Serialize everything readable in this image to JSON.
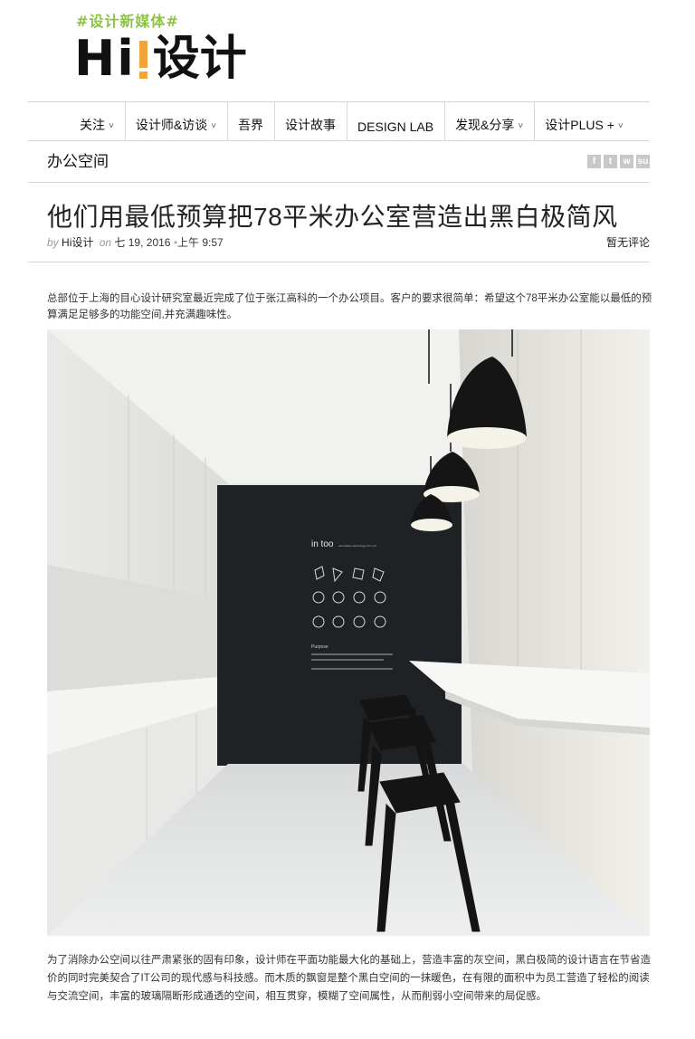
{
  "header": {
    "tagline": "#设计新媒体#",
    "logo_hi": "Hi",
    "logo_cn": "设计"
  },
  "nav": [
    {
      "label": "关注",
      "caret": true
    },
    {
      "label": "设计师&访谈",
      "caret": true
    },
    {
      "label": "吾界",
      "caret": false
    },
    {
      "label": "设计故事",
      "caret": false
    },
    {
      "label": "DESIGN LAB",
      "caret": false
    },
    {
      "label": "发现&分享",
      "caret": true
    },
    {
      "label": "设计PLUS +",
      "caret": true
    }
  ],
  "section": "办公空间",
  "social_icons": [
    "facebook-icon",
    "twitter-icon",
    "weibo-icon",
    "stumbleupon-icon"
  ],
  "social_glyphs": [
    "f",
    "t",
    "w",
    "su"
  ],
  "article": {
    "title": "他们用最低预算把78平米办公室营造出黑白极简风",
    "by": "by",
    "author": "Hi设计",
    "on": "on",
    "date": "七 19, 2016",
    "time": "上午 9:57",
    "comments": "暂无评论",
    "intro": "总部位于上海的目心设计研究室最近完成了位于张江高科的一个办公项目。客户的要求很简单：希望这个78平米办公室能以最低的预算满足足够多的功能空间,并充满趣味性。",
    "body": "为了消除办公空间以往严肃紧张的固有印象，设计师在平面功能最大化的基础上，营造丰富的灰空间，黑白极简的设计语言在节省造价的同时完美契合了IT公司的现代感与科技感。而木质的飘窗是整个黑白空间的一抹暖色，在有限的面积中为员工营造了轻松的阅读与交流空间，丰富的玻璃隔断形成通透的空间，相互贯穿，模糊了空间属性，从而削弱小空间带来的局促感。"
  },
  "photo": {
    "wall_brand": "in too",
    "wall_sub": "automation technology CO.,Ltd",
    "wall_caption": "Purpose"
  },
  "colors": {
    "tagline": "#8cc43f",
    "logo_accent": "#f0a43a"
  }
}
